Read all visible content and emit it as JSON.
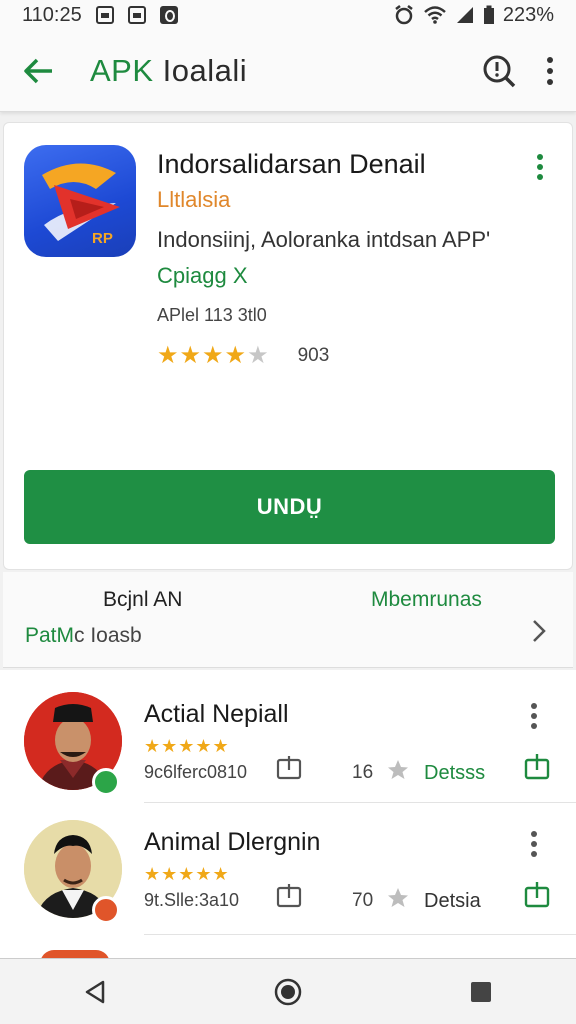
{
  "status_bar": {
    "time": "110:25",
    "battery": "223%"
  },
  "app_bar": {
    "title_prefix": "APK",
    "title_rest": " Ioalali"
  },
  "app": {
    "name": "Indorsalidarsan Denail",
    "developer": "Lltlalsia",
    "description": "Indonsiinj, Aoloranka intdsan APP'",
    "tag": "Cpiagg X",
    "version": "APlel 113 3tl0",
    "rating_stars": 4.5,
    "rating_count": "903",
    "download_label": "UNDṲ"
  },
  "info": {
    "left_label": "Bcjnl AN",
    "right_label": "Mbemrunas",
    "bottom_label_green": "PatM",
    "bottom_label_gray": "c Ioasb"
  },
  "list": [
    {
      "name": "Actial Nepiall",
      "stars": 5,
      "meta": "9c6lferc0810",
      "count": "16",
      "detail_label": "Detsss"
    },
    {
      "name": "Animal Dlergnin",
      "stars": 5,
      "meta": "9t.Slle:3a10",
      "count": "70",
      "detail_label": "Detsia"
    }
  ],
  "colors": {
    "accent_green": "#1f8f44",
    "star_gold": "#f0a818",
    "developer_orange": "#e0872b"
  }
}
